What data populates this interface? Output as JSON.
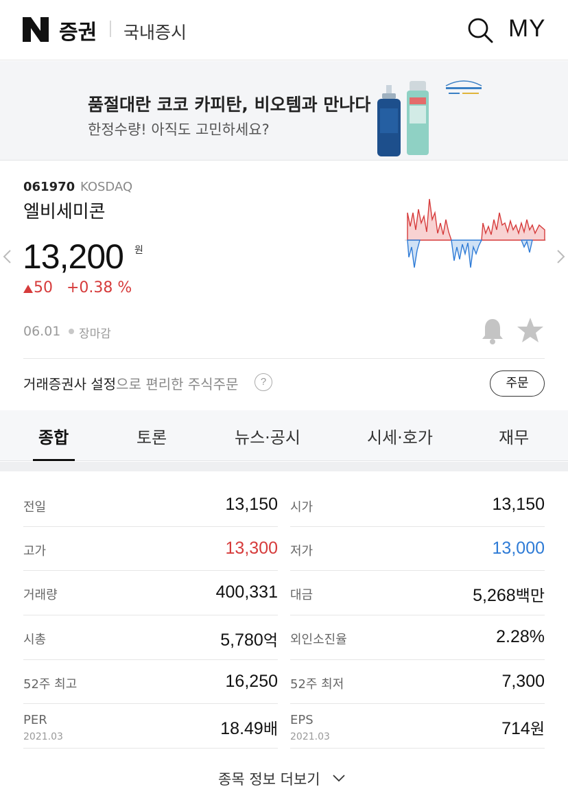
{
  "header": {
    "logo": "N",
    "brand": "증권",
    "section": "국내증시",
    "my_label": "MY"
  },
  "ad": {
    "title": "품절대란 코코 카피탄, 비오템과 만나다",
    "subtitle": "한정수량! 아직도 고민하세요?",
    "logo_text": "BIOTHERM"
  },
  "stock": {
    "code": "061970",
    "market": "KOSDAQ",
    "name": "엘비세미콘",
    "price": "13,200",
    "price_unit": "원",
    "change_amount": "50",
    "change_percent": "+0.38 %",
    "date": "06.01",
    "status": "장마감"
  },
  "colors": {
    "up": "#d63b3b",
    "down": "#2e7bd6"
  },
  "broker": {
    "prefix": "거래증권사 설정",
    "suffix": "으로 편리한 주식주문",
    "help": "?",
    "order_label": "주문"
  },
  "tabs": [
    {
      "label": "종합",
      "active": true
    },
    {
      "label": "토론",
      "active": false
    },
    {
      "label": "뉴스·공시",
      "active": false
    },
    {
      "label": "시세·호가",
      "active": false
    },
    {
      "label": "재무",
      "active": false
    }
  ],
  "info": {
    "left": [
      {
        "label": "전일",
        "value": "13,150"
      },
      {
        "label": "고가",
        "value": "13,300"
      },
      {
        "label": "거래량",
        "value": "400,331"
      },
      {
        "label": "시총",
        "value": "5,780",
        "unit": "억"
      },
      {
        "label": "52주 최고",
        "value": "16,250"
      },
      {
        "label": "PER",
        "sublabel": "2021.03",
        "value": "18.49",
        "unit": "배"
      }
    ],
    "right": [
      {
        "label": "시가",
        "value": "13,150"
      },
      {
        "label": "저가",
        "value": "13,000"
      },
      {
        "label": "대금",
        "value": "5,268",
        "unit": "백만"
      },
      {
        "label": "외인소진율",
        "value": "2.28%"
      },
      {
        "label": "52주 최저",
        "value": "7,300"
      },
      {
        "label": "EPS",
        "sublabel": "2021.03",
        "value": "714",
        "unit": "원"
      }
    ]
  },
  "more_label": "종목 정보 더보기"
}
